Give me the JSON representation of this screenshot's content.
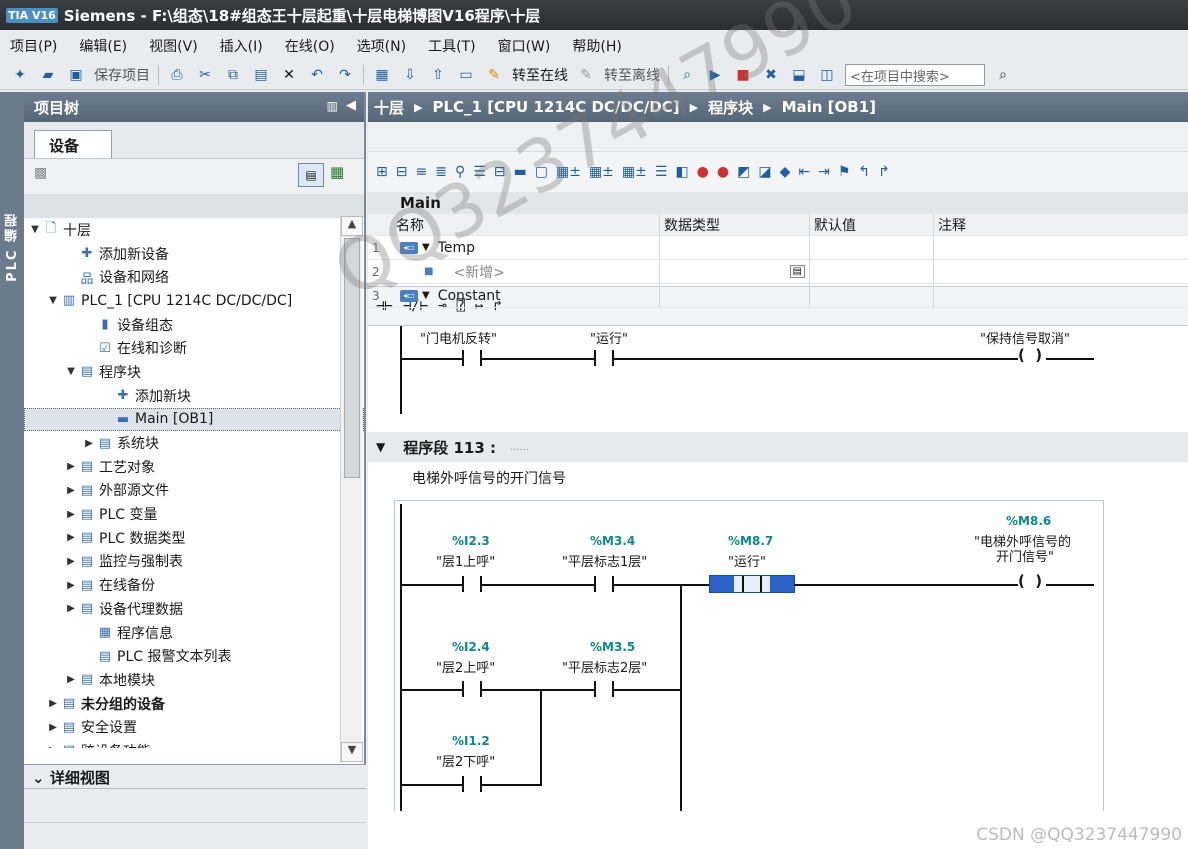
{
  "window": {
    "title": "Siemens  -  F:\\组态\\18#组态王十层起重\\十层电梯博图V16程序\\十层",
    "logo": "TIA V16"
  },
  "menu": [
    "项目(P)",
    "编辑(E)",
    "视图(V)",
    "插入(I)",
    "在线(O)",
    "选项(N)",
    "工具(T)",
    "窗口(W)",
    "帮助(H)"
  ],
  "toolbar": {
    "save_project": "保存项目",
    "go_online": "转至在线",
    "go_offline": "转至离线",
    "search_placeholder": "<在项目中搜索>"
  },
  "vstrip": {
    "label": "PLC 编程"
  },
  "project_tree": {
    "title": "项目树",
    "devices_tab": "设备",
    "items": [
      {
        "label": "十层",
        "level": 0,
        "twisty": "▼",
        "icon": "project-icon",
        "glyph": "🗋"
      },
      {
        "label": "添加新设备",
        "level": 2,
        "twisty": "",
        "icon": "add-device-icon",
        "glyph": "✚"
      },
      {
        "label": "设备和网络",
        "level": 2,
        "twisty": "",
        "icon": "network-icon",
        "glyph": "品"
      },
      {
        "label": "PLC_1 [CPU 1214C DC/DC/DC]",
        "level": 1,
        "twisty": "▼",
        "icon": "plc-icon",
        "glyph": "▥"
      },
      {
        "label": "设备组态",
        "level": 3,
        "twisty": "",
        "icon": "device-config-icon",
        "glyph": "▮"
      },
      {
        "label": "在线和诊断",
        "level": 3,
        "twisty": "",
        "icon": "diagnostics-icon",
        "glyph": "☑"
      },
      {
        "label": "程序块",
        "level": 2,
        "twisty": "▼",
        "icon": "folder-icon",
        "glyph": "▤"
      },
      {
        "label": "添加新块",
        "level": 4,
        "twisty": "",
        "icon": "add-block-icon",
        "glyph": "✚"
      },
      {
        "label": "Main [OB1]",
        "level": 4,
        "twisty": "",
        "icon": "ob-icon",
        "glyph": "▬",
        "selected": true
      },
      {
        "label": "系统块",
        "level": 3,
        "twisty": "▶",
        "icon": "folder-icon",
        "glyph": "▤"
      },
      {
        "label": "工艺对象",
        "level": 2,
        "twisty": "▶",
        "icon": "folder-icon",
        "glyph": "▤"
      },
      {
        "label": "外部源文件",
        "level": 2,
        "twisty": "▶",
        "icon": "folder-icon",
        "glyph": "▤"
      },
      {
        "label": "PLC 变量",
        "level": 2,
        "twisty": "▶",
        "icon": "folder-icon",
        "glyph": "▤"
      },
      {
        "label": "PLC 数据类型",
        "level": 2,
        "twisty": "▶",
        "icon": "folder-icon",
        "glyph": "▤"
      },
      {
        "label": "监控与强制表",
        "level": 2,
        "twisty": "▶",
        "icon": "folder-icon",
        "glyph": "▤"
      },
      {
        "label": "在线备份",
        "level": 2,
        "twisty": "▶",
        "icon": "folder-icon",
        "glyph": "▤"
      },
      {
        "label": "设备代理数据",
        "level": 2,
        "twisty": "▶",
        "icon": "folder-icon",
        "glyph": "▤"
      },
      {
        "label": "程序信息",
        "level": 3,
        "twisty": "",
        "icon": "info-icon",
        "glyph": "▦"
      },
      {
        "label": "PLC 报警文本列表",
        "level": 3,
        "twisty": "",
        "icon": "list-icon",
        "glyph": "▤"
      },
      {
        "label": "本地模块",
        "level": 2,
        "twisty": "▶",
        "icon": "folder-icon",
        "glyph": "▤"
      },
      {
        "label": "未分组的设备",
        "level": 1,
        "twisty": "▶",
        "icon": "folder-icon",
        "glyph": "▤",
        "bold": true
      },
      {
        "label": "安全设置",
        "level": 1,
        "twisty": "▶",
        "icon": "security-icon",
        "glyph": "▤"
      },
      {
        "label": "跨设备功能",
        "level": 1,
        "twisty": "▶",
        "icon": "folder-icon",
        "glyph": "▤"
      }
    ],
    "detail_view": "详细视图"
  },
  "breadcrumb": [
    "十层",
    "PLC_1 [CPU 1214C DC/DC/DC]",
    "程序块",
    "Main [OB1]"
  ],
  "interface": {
    "block_name": "Main",
    "headers": [
      "名称",
      "数据类型",
      "默认值",
      "注释"
    ],
    "rows": [
      {
        "num": "1",
        "name": "Temp",
        "pin": true,
        "twisty": "▼"
      },
      {
        "num": "2",
        "name": "<新增>",
        "pin": false,
        "twisty": ""
      },
      {
        "num": "3",
        "name": "Constant",
        "pin": true,
        "twisty": "▼"
      }
    ]
  },
  "ladder_toolbar": [
    "⊣⊢",
    "⊣/⊢",
    "⊸",
    "⍰",
    "↦",
    "↱"
  ],
  "network_prev": {
    "contact1": "\"门电机反转\"",
    "contact2": "\"运行\"",
    "coil": "\"保持信号取消\""
  },
  "network_113": {
    "title": "程序段 113 :",
    "title_suffix": "......",
    "comment": "电梯外呼信号的开门信号",
    "c1_addr": "%I2.3",
    "c1_name": "\"层1上呼\"",
    "c2_addr": "%M3.4",
    "c2_name": "\"平层标志1层\"",
    "c3_addr": "%M8.7",
    "c3_name": "\"运行\"",
    "coil_addr": "%M8.6",
    "coil_name_1": "\"电梯外呼信号的",
    "coil_name_2": "开门信号\"",
    "c4_addr": "%I2.4",
    "c4_name": "\"层2上呼\"",
    "c5_addr": "%M3.5",
    "c5_name": "\"平层标志2层\"",
    "c6_addr": "%I1.2",
    "c6_name": "\"层2下呼\""
  },
  "overlay": {
    "watermark": "QQ3237447990",
    "csdn": "CSDN @QQ3237447990"
  }
}
